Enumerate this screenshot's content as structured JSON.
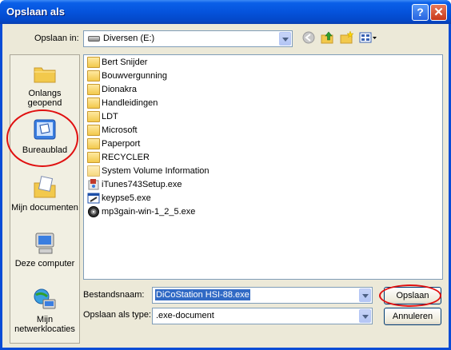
{
  "window": {
    "title": "Opslaan als"
  },
  "toolbar": {
    "save_in_label": "Opslaan in:",
    "location": "Diversen (E:)",
    "location_icon": "drive-icon"
  },
  "places": [
    {
      "label": "Onlangs geopend",
      "icon": "recent-folder-icon"
    },
    {
      "label": "Bureaublad",
      "icon": "desktop-icon"
    },
    {
      "label": "Mijn documenten",
      "icon": "my-documents-icon"
    },
    {
      "label": "Deze computer",
      "icon": "my-computer-icon"
    },
    {
      "label": "Mijn netwerklocaties",
      "icon": "network-places-icon"
    }
  ],
  "files": [
    {
      "name": "Bert Snijder",
      "icon": "folder-icon"
    },
    {
      "name": "Bouwvergunning",
      "icon": "folder-icon"
    },
    {
      "name": "Dionakra",
      "icon": "folder-icon"
    },
    {
      "name": "Handleidingen",
      "icon": "folder-icon"
    },
    {
      "name": "LDT",
      "icon": "folder-icon"
    },
    {
      "name": "Microsoft",
      "icon": "folder-icon"
    },
    {
      "name": "Paperport",
      "icon": "folder-icon"
    },
    {
      "name": "RECYCLER",
      "icon": "folder-icon"
    },
    {
      "name": "System Volume Information",
      "icon": "system-folder-icon"
    },
    {
      "name": "iTunes743Setup.exe",
      "icon": "installer-icon"
    },
    {
      "name": "keypse5.exe",
      "icon": "exe-icon"
    },
    {
      "name": "mp3gain-win-1_2_5.exe",
      "icon": "disc-exe-icon"
    }
  ],
  "form": {
    "filename_label": "Bestandsnaam:",
    "filename_value": "DiCoStation HSI-88.exe",
    "filetype_label": "Opslaan als type:",
    "filetype_value": ".exe-document",
    "save_button": "Opslaan",
    "cancel_button": "Annuleren"
  },
  "colors": {
    "title_bar": "#0a5fe8",
    "dialog_bg": "#ece9d8",
    "highlight": "#316ac5",
    "annotation_ring": "#e01010"
  }
}
